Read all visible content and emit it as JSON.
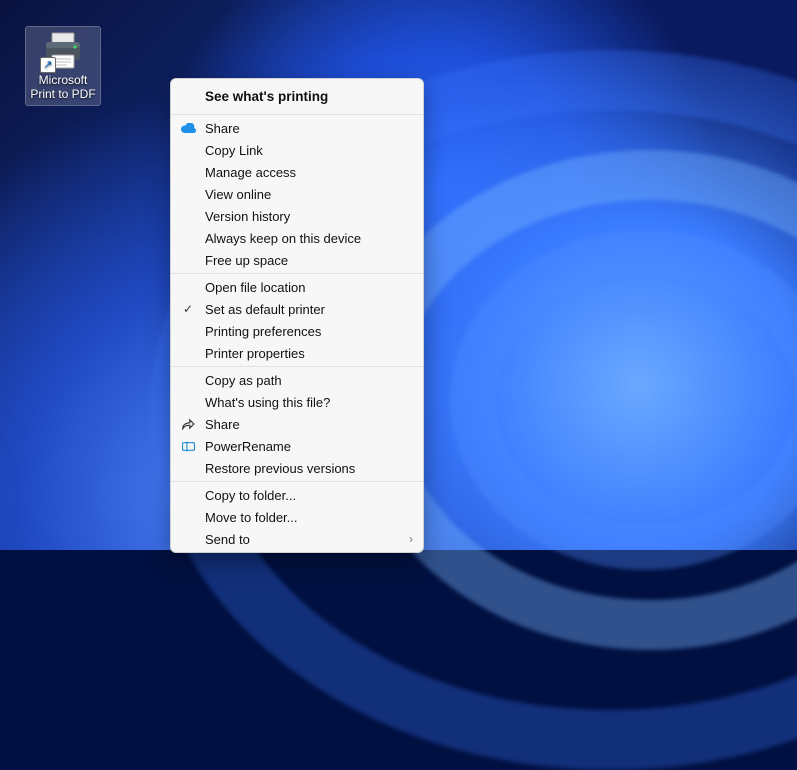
{
  "desktop": {
    "printer_icon": {
      "label_line1": "Microsoft",
      "label_line2": "Print to PDF"
    }
  },
  "context_menu": {
    "header": "See what's printing",
    "groups": [
      {
        "items": [
          {
            "id": "share-onedrive",
            "label": "Share",
            "icon": "cloud-icon"
          },
          {
            "id": "copy-link",
            "label": "Copy Link"
          },
          {
            "id": "manage-access",
            "label": "Manage access"
          },
          {
            "id": "view-online",
            "label": "View online"
          },
          {
            "id": "version-history",
            "label": "Version history"
          },
          {
            "id": "always-keep",
            "label": "Always keep on this device"
          },
          {
            "id": "free-up-space",
            "label": "Free up space"
          }
        ]
      },
      {
        "items": [
          {
            "id": "open-file-location",
            "label": "Open file location"
          },
          {
            "id": "set-default-printer",
            "label": "Set as default printer",
            "icon": "check-icon"
          },
          {
            "id": "printing-preferences",
            "label": "Printing preferences"
          },
          {
            "id": "printer-properties",
            "label": "Printer properties"
          }
        ]
      },
      {
        "items": [
          {
            "id": "copy-as-path",
            "label": "Copy as path"
          },
          {
            "id": "whats-using",
            "label": "What's using this file?"
          },
          {
            "id": "share-system",
            "label": "Share",
            "icon": "share-icon"
          },
          {
            "id": "powerrename",
            "label": "PowerRename",
            "icon": "powerrename-icon"
          },
          {
            "id": "restore-previous",
            "label": "Restore previous versions"
          }
        ]
      },
      {
        "items": [
          {
            "id": "copy-to-folder",
            "label": "Copy to folder..."
          },
          {
            "id": "move-to-folder",
            "label": "Move to folder..."
          },
          {
            "id": "send-to",
            "label": "Send to",
            "submenu": true
          }
        ]
      }
    ]
  }
}
